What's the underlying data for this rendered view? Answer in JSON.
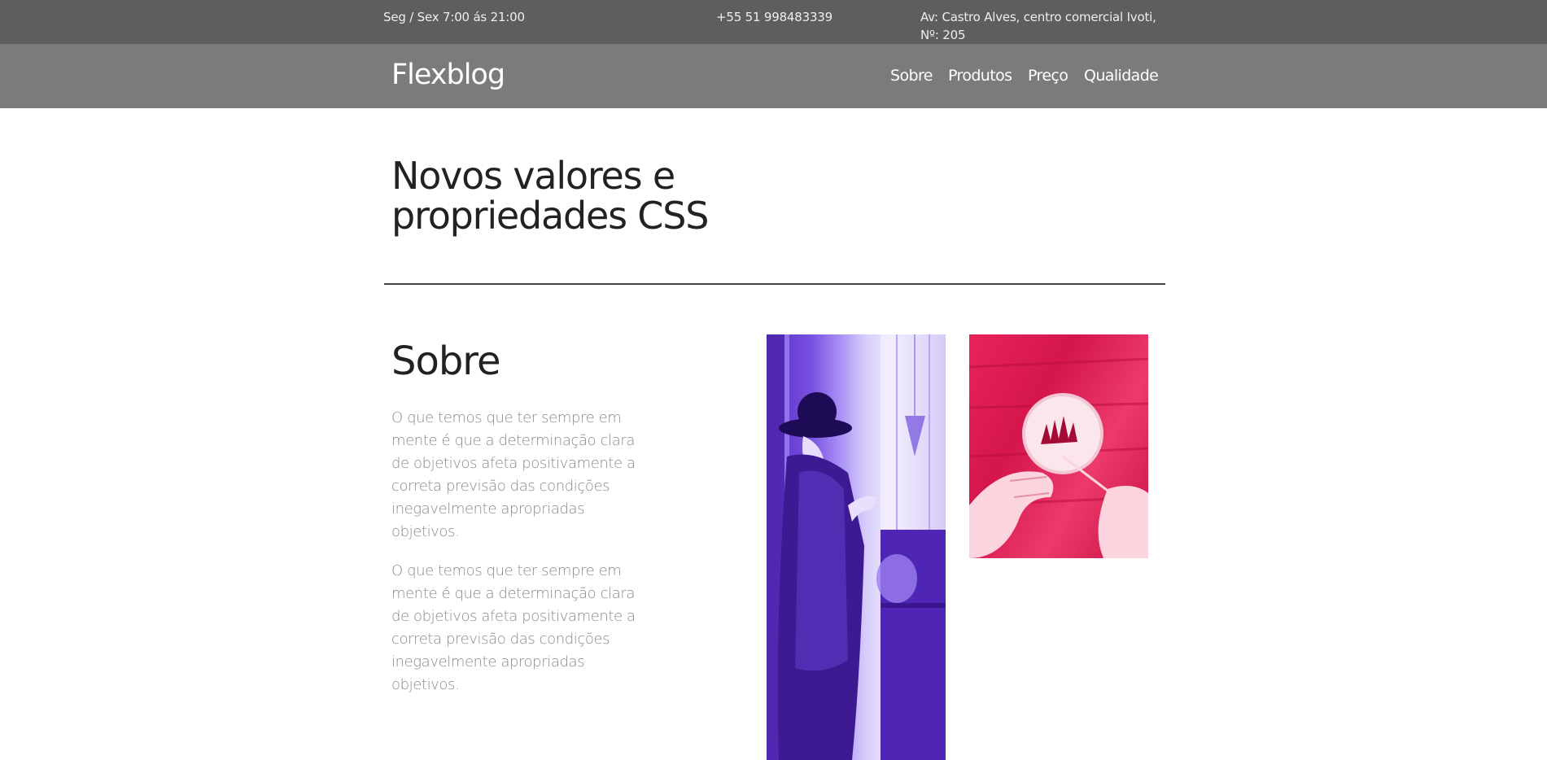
{
  "topbar": {
    "hours": "Seg / Sex 7:00 ás 21:00",
    "phone": "+55 51 998483339",
    "address": "Av: Castro Alves, centro comercial Ivoti, Nº: 205"
  },
  "nav": {
    "brand": "Flexblog",
    "links": [
      "Sobre",
      "Produtos",
      "Preço",
      "Qualidade"
    ]
  },
  "hero": {
    "title": "Novos valores e propriedades CSS"
  },
  "about": {
    "heading": "Sobre",
    "paragraphs": [
      "O que temos que ter sempre em mente é que a determinação clara de objetivos afeta positivamente a correta previsão das condições inegavelmente apropriadas objetivos.",
      "O que temos que ter sempre em mente é que a determinação clara de objetivos afeta positivamente a correta previsão das condições inegavelmente apropriadas objetivos."
    ]
  },
  "images": [
    {
      "name": "woman-hat-photo",
      "tint": "#6a3fd8"
    },
    {
      "name": "embroidery-hoop-photo",
      "tint": "#e0265a"
    }
  ],
  "colors": {
    "topbar_bg": "#5e5e5e",
    "navbar_bg": "#7b7b7b",
    "heading_text": "#222222",
    "body_text": "#8a8a8a"
  }
}
